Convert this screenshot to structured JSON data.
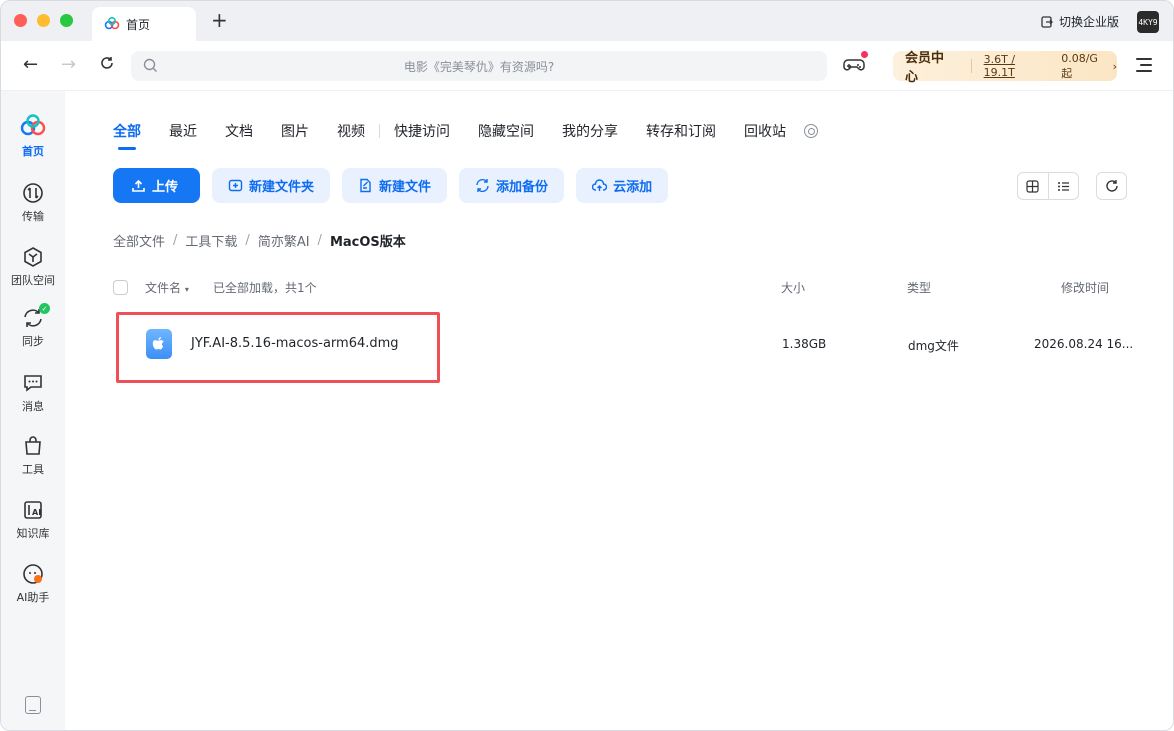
{
  "tab": {
    "title": "首页"
  },
  "titlebar": {
    "switch_enterprise": "切换企业版",
    "avatar_text": "4KY9"
  },
  "toolbar": {
    "search_placeholder": "电影《完美琴仇》有资源吗?",
    "vip": {
      "title": "会员中心",
      "quota": "3.6T / 19.1T",
      "price": "0.08/G起"
    }
  },
  "sidebar": {
    "items": [
      {
        "label": "首页",
        "icon": "home-logo-icon",
        "active": true
      },
      {
        "label": "传输",
        "icon": "transfer-icon"
      },
      {
        "label": "团队空间",
        "icon": "team-space-icon"
      },
      {
        "label": "同步",
        "icon": "sync-icon"
      },
      {
        "label": "消息",
        "icon": "message-icon"
      },
      {
        "label": "工具",
        "icon": "tools-icon"
      },
      {
        "label": "知识库",
        "icon": "knowledge-base-icon"
      },
      {
        "label": "AI助手",
        "icon": "ai-assistant-icon"
      }
    ]
  },
  "main": {
    "tabs": [
      "全部",
      "最近",
      "文档",
      "图片",
      "视频",
      "快捷访问",
      "隐藏空间",
      "我的分享",
      "转存和订阅",
      "回收站"
    ],
    "actions": {
      "upload": "上传",
      "new_folder": "新建文件夹",
      "new_file": "新建文件",
      "add_backup": "添加备份",
      "cloud_add": "云添加"
    },
    "breadcrumb": [
      "全部文件",
      "工具下载",
      "简亦繁AI",
      "MacOS版本"
    ],
    "table": {
      "headers": {
        "name": "文件名",
        "loaded": "已全部加载，共1个",
        "size": "大小",
        "type": "类型",
        "mtime": "修改时间"
      },
      "rows": [
        {
          "name": "JYF.AI-8.5.16-macos-arm64.dmg",
          "size": "1.38GB",
          "type": "dmg文件",
          "mtime": "2026.08.24 16..."
        }
      ]
    }
  },
  "colors": {
    "accent": "#0d6cf2",
    "highlight": "#ef4f56"
  }
}
